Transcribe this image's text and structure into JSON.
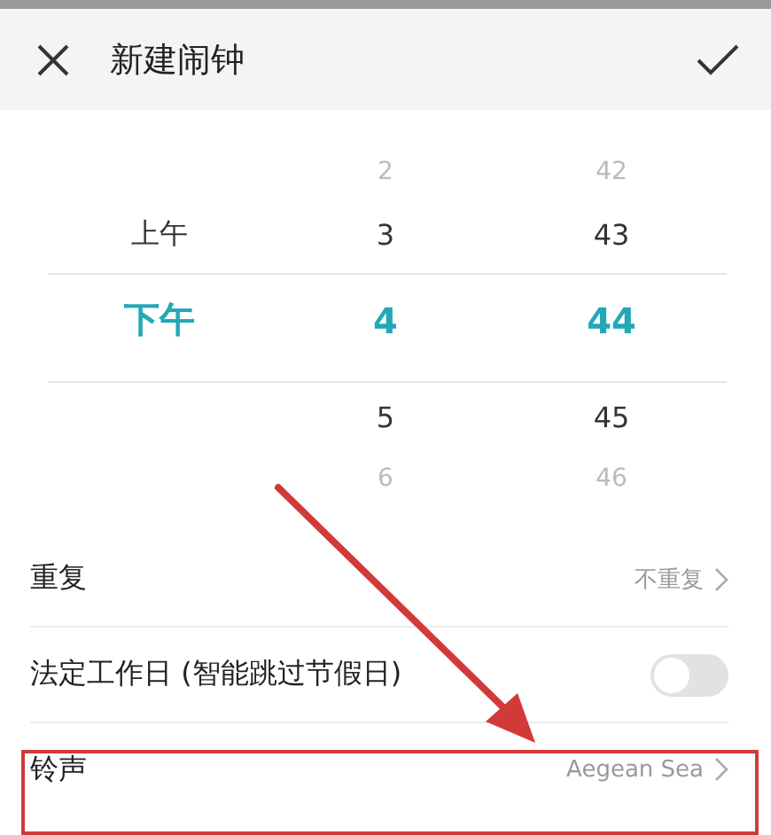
{
  "header": {
    "title": "新建闹钟"
  },
  "picker": {
    "columns": [
      {
        "items": [
          {
            "text": "上午",
            "selected": false
          },
          {
            "text": "下午",
            "selected": true
          }
        ]
      },
      {
        "items": [
          {
            "text": "2",
            "selected": false
          },
          {
            "text": "3",
            "selected": false
          },
          {
            "text": "4",
            "selected": true
          },
          {
            "text": "5",
            "selected": false
          },
          {
            "text": "6",
            "selected": false
          }
        ]
      },
      {
        "items": [
          {
            "text": "42",
            "selected": false
          },
          {
            "text": "43",
            "selected": false
          },
          {
            "text": "44",
            "selected": true
          },
          {
            "text": "45",
            "selected": false
          },
          {
            "text": "46",
            "selected": false
          }
        ]
      }
    ]
  },
  "settings": [
    {
      "kind": "link",
      "label": "重复",
      "value": "不重复"
    },
    {
      "kind": "toggle",
      "label": "法定工作日 (智能跳过节假日)",
      "on": false
    },
    {
      "kind": "link",
      "label": "铃声",
      "value": "Aegean Sea"
    }
  ]
}
